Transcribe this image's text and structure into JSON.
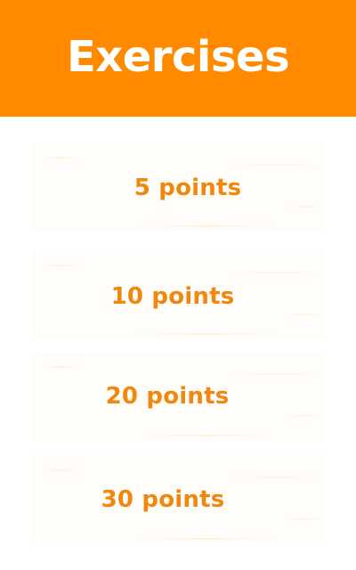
{
  "header": {
    "title": "Exercises"
  },
  "items": [
    {
      "label": "5 points"
    },
    {
      "label": "10 points"
    },
    {
      "label": "20 points"
    },
    {
      "label": "30 points"
    }
  ],
  "colors": {
    "header_bg": "#ff8a00",
    "accent_text": "#f2870d"
  }
}
